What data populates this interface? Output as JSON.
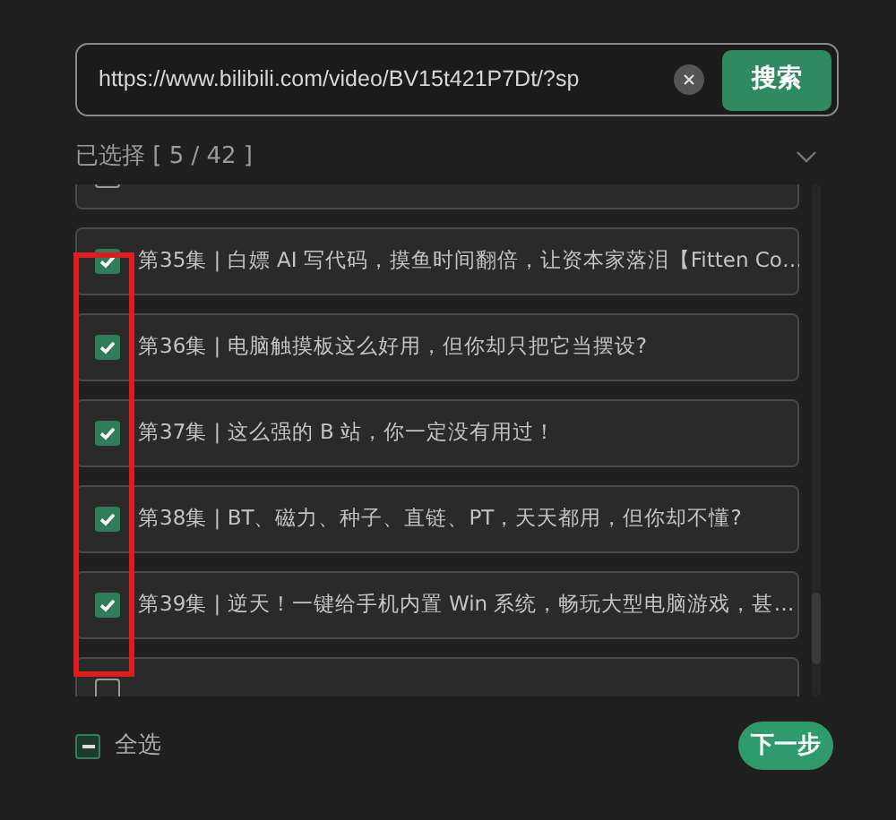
{
  "search": {
    "value": "https://www.bilibili.com/video/BV15t421P7Dt/?sp",
    "button": "搜索"
  },
  "selection": {
    "label": "已选择 [ 5 / 42 ]",
    "expanded": true
  },
  "episodes": [
    {
      "checked": false
    },
    {
      "title": "第35集 | 白嫖 AI 写代码，摸鱼时间翻倍，让资本家落泪【Fitten Co…",
      "checked": true
    },
    {
      "title": "第36集 | 电脑触摸板这么好用，但你却只把它当摆设?",
      "checked": true
    },
    {
      "title": "第37集 | 这么强的 B 站，你一定没有用过！",
      "checked": true
    },
    {
      "title": "第38集 | BT、磁力、种子、直链、PT，天天都用，但你却不懂?",
      "checked": true
    },
    {
      "title": "第39集 | 逆天！一键给手机内置 Win 系统，畅玩大型电脑游戏，甚…",
      "checked": true
    },
    {
      "checked": false
    }
  ],
  "highlight_frame": {
    "shown": true
  },
  "footer": {
    "select_all": "全选",
    "select_all_indeterminate": true,
    "next": "下一步"
  }
}
